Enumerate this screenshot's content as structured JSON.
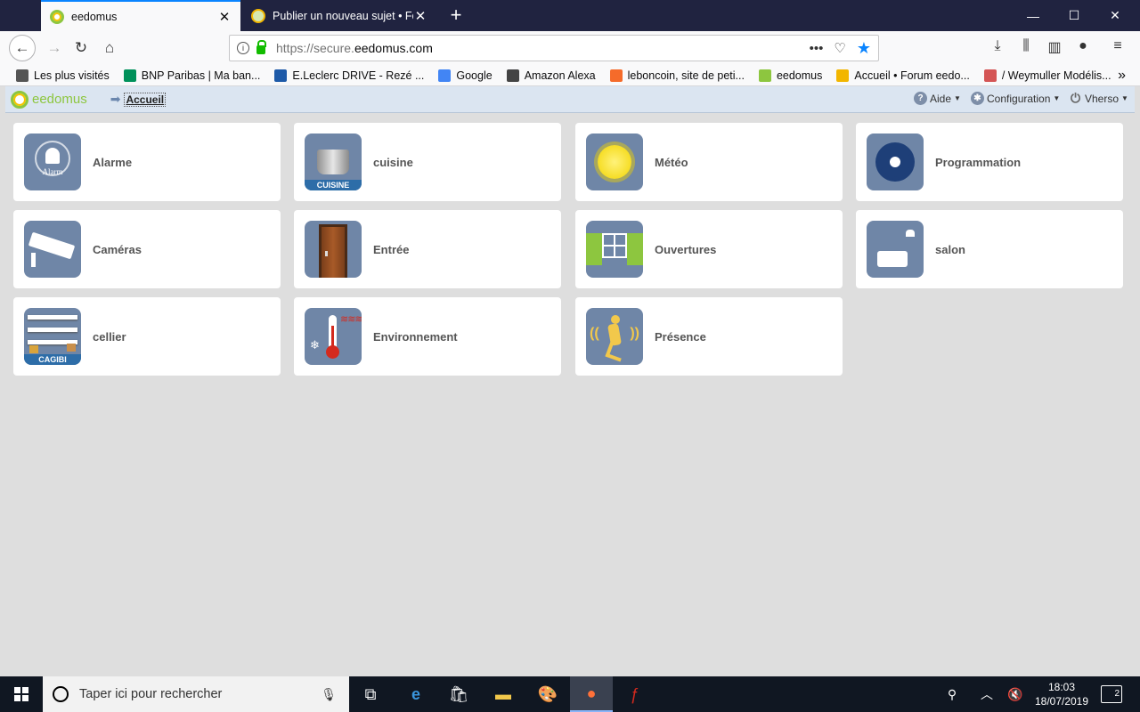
{
  "browser": {
    "tabs": [
      {
        "title": "eedomus",
        "active": true
      },
      {
        "title": "Publier un nouveau sujet • Forum",
        "active": false
      }
    ],
    "url_prefix": "https://secure.",
    "url_domain": "eedomus.com",
    "bookmarks": [
      {
        "label": "Les plus visités",
        "icon": "gear-icon",
        "color": "#555555"
      },
      {
        "label": "BNP Paribas | Ma ban...",
        "icon": "bnp-icon",
        "color": "#00915a"
      },
      {
        "label": "E.Leclerc DRIVE - Rezé ...",
        "icon": "leclerc-icon",
        "color": "#1e5aa8"
      },
      {
        "label": "Google",
        "icon": "google-icon",
        "color": "#4285f4"
      },
      {
        "label": "Amazon Alexa",
        "icon": "globe-icon",
        "color": "#444444"
      },
      {
        "label": "leboncoin, site de peti...",
        "icon": "leboncoin-icon",
        "color": "#f56b2a"
      },
      {
        "label": "eedomus",
        "icon": "eedomus-icon",
        "color": "#8dc63f"
      },
      {
        "label": "Accueil • Forum eedo...",
        "icon": "forum-icon",
        "color": "#f2b600"
      },
      {
        "label": "/ Weymuller Modélis...",
        "icon": "weymuller-icon",
        "color": "#d45555"
      }
    ]
  },
  "app": {
    "logo_text": "eedomus",
    "breadcrumb": "Accueil",
    "menu": {
      "aide": "Aide",
      "configuration": "Configuration",
      "user": "Vherso"
    },
    "tiles": [
      {
        "name": "Alarme",
        "icon_text": "Alarm"
      },
      {
        "name": "cuisine",
        "icon_text": "CUISINE"
      },
      {
        "name": "Météo"
      },
      {
        "name": "Programmation"
      },
      {
        "name": "Caméras"
      },
      {
        "name": "Entrée"
      },
      {
        "name": "Ouvertures"
      },
      {
        "name": "salon"
      },
      {
        "name": "cellier",
        "icon_text": "CAGIBI"
      },
      {
        "name": "Environnement"
      },
      {
        "name": "Présence"
      }
    ]
  },
  "taskbar": {
    "search_placeholder": "Taper ici pour rechercher",
    "time": "18:03",
    "date": "18/07/2019",
    "notifications": "2"
  },
  "colors": {
    "accent": "#0a84ff",
    "brand_green": "#8dc63f",
    "tile_icon_bg": "#6f86a7"
  }
}
